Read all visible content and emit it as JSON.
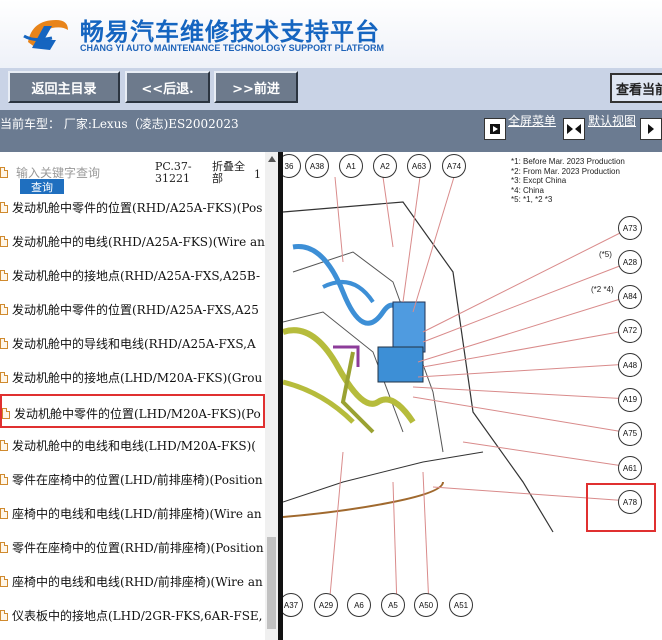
{
  "header": {
    "title_cn": "畅易汽车维修技术支持平台",
    "title_en": "CHANG YI AUTO MAINTENANCE TECHNOLOGY SUPPORT PLATFORM",
    "logo_icon": "cy-logo-icon"
  },
  "toolbar": {
    "main_menu": "返回主目录",
    "back": "<<后退.",
    "forward": ">>前进",
    "view_current": "查看当前"
  },
  "infobar": {
    "current_model": "当前车型： 厂家:Lexus（凌志)ES2002023",
    "fullscreen_menu": "全屏菜单",
    "default_view": "默认视图"
  },
  "sidebar": {
    "search_placeholder": "输入关键字查询",
    "search_button": "查询",
    "pc_code": "PC.37-31221",
    "collapse_all": "折叠全部",
    "stub_text": "1",
    "items": [
      {
        "label": "发动机舱中零件的位置(RHD/A25A-FKS)(Pos",
        "selected": false
      },
      {
        "label": "发动机舱中的电线(RHD/A25A-FKS)(Wire and",
        "selected": false
      },
      {
        "label": "发动机舱中的接地点(RHD/A25A-FXS,A25B-",
        "selected": false
      },
      {
        "label": "发动机舱中零件的位置(RHD/A25A-FXS,A25",
        "selected": false
      },
      {
        "label": "发动机舱中的导线和电线(RHD/A25A-FXS,A",
        "selected": false
      },
      {
        "label": "发动机舱中的接地点(LHD/M20A-FKS)(Grou",
        "selected": false
      },
      {
        "label": "发动机舱中零件的位置(LHD/M20A-FKS)(Po",
        "selected": true
      },
      {
        "label": "发动机舱中的电线和电线(LHD/M20A-FKS)(",
        "selected": false
      },
      {
        "label": "零件在座椅中的位置(LHD/前排座椅)(Position",
        "selected": false
      },
      {
        "label": "座椅中的电线和电线(LHD/前排座椅)(Wire an",
        "selected": false
      },
      {
        "label": "零件在座椅中的位置(RHD/前排座椅)(Position",
        "selected": false
      },
      {
        "label": "座椅中的电线和电线(RHD/前排座椅)(Wire an",
        "selected": false
      },
      {
        "label": "仪表板中的接地点(LHD/2GR-FKS,6AR-FSE,",
        "selected": false
      }
    ]
  },
  "diagram": {
    "notes": [
      "*1: Before Mar. 2023 Production",
      "*2: From Mar. 2023 Production",
      "*3: Excpt China",
      "*4: China",
      "*5: *1, *2 *3"
    ],
    "top_connectors": [
      "36",
      "A38",
      "A1",
      "A2",
      "A63",
      "A74"
    ],
    "right_connectors": [
      "A73",
      "A28",
      "A84",
      "A72",
      "A48",
      "A19",
      "A75",
      "A61",
      "A78"
    ],
    "right_annotations": [
      "(*5)",
      "(*2 *4)"
    ],
    "bottom_connectors": [
      "A37",
      "A29",
      "A6",
      "A5",
      "A50",
      "A51"
    ],
    "highlighted_connector": "A78"
  },
  "colors": {
    "accent_blue": "#1565c0",
    "toolbar_bg": "#c9d3e6",
    "infobar_bg": "#6b7b91",
    "highlight_red": "#e03030"
  }
}
